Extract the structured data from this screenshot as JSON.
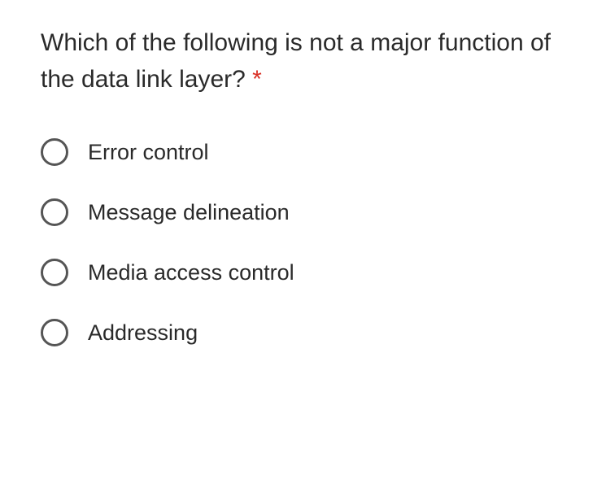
{
  "question": {
    "text": "Which of the following is not a major function of the data link layer? ",
    "required_marker": "*"
  },
  "options": [
    {
      "label": "Error control"
    },
    {
      "label": "Message delineation"
    },
    {
      "label": "Media access control"
    },
    {
      "label": "Addressing"
    }
  ]
}
